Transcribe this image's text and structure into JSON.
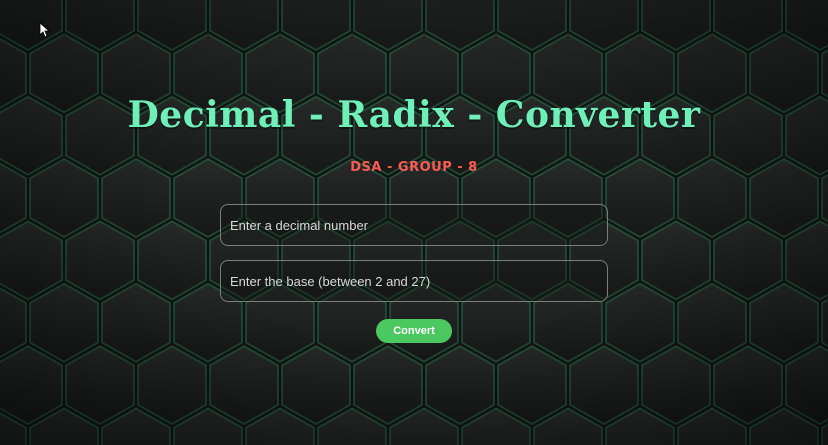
{
  "app": {
    "title": "Decimal - Radix - Converter",
    "subtitle": "DSA - GROUP - 8"
  },
  "form": {
    "decimal_input": {
      "placeholder": "Enter a decimal number",
      "value": ""
    },
    "base_input": {
      "placeholder": "Enter the base (between 2 and 27)",
      "value": ""
    },
    "convert_label": "Convert"
  },
  "colors": {
    "title": "#6ef0b8",
    "subtitle": "#ff5a52",
    "button": "#4cc861",
    "background": "#171a18",
    "hex_edge_glow": "#2f8a5a"
  },
  "icons": {
    "cursor": "mouse-pointer-icon"
  }
}
